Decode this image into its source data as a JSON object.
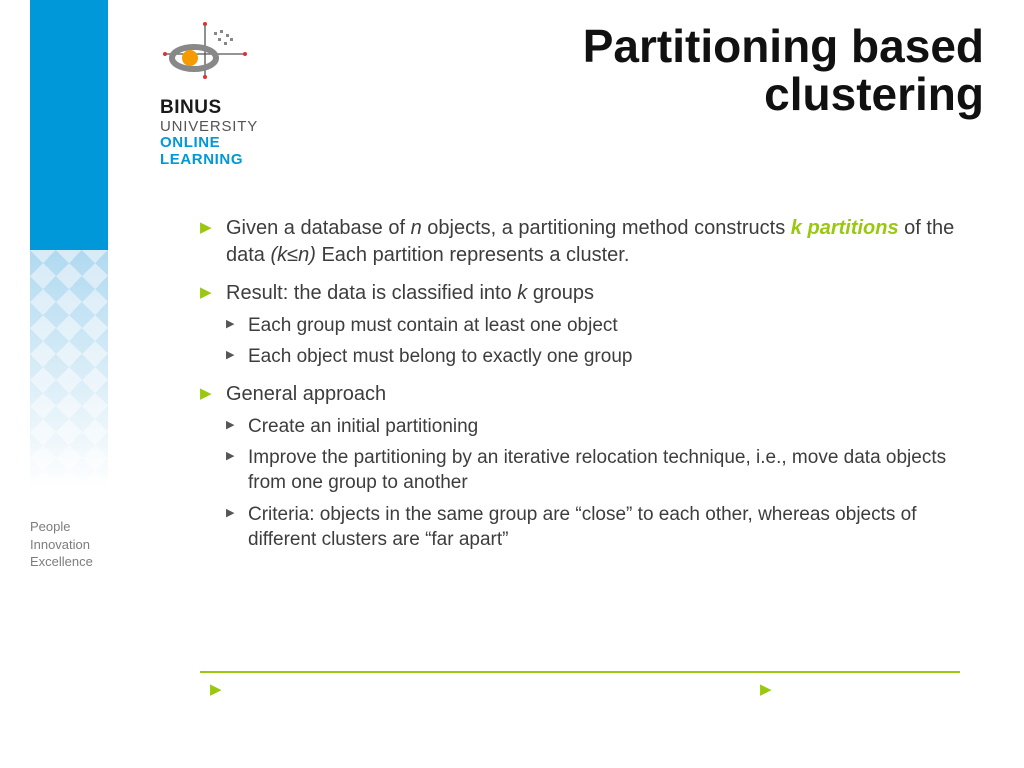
{
  "colors": {
    "accent_blue": "#0098d8",
    "accent_green": "#9ac80f"
  },
  "tagline": {
    "l1": "People",
    "l2": "Innovation",
    "l3": "Excellence"
  },
  "logo": {
    "line1": "BINUS",
    "line2": "UNIVERSITY",
    "line3": "ONLINE",
    "line4": "LEARNING"
  },
  "title": {
    "line1": "Partitioning based",
    "line2": "clustering"
  },
  "bullets": {
    "b1": {
      "pre": "Given a database of ",
      "var1": "n",
      "mid1": " objects, a partitioning method constructs ",
      "emph": "k partitions",
      "mid2": " of the data ",
      "cond": "(k≤n)",
      "post": " Each partition represents a cluster."
    },
    "b2": {
      "pre": "Result: the data is classified into ",
      "var1": "k",
      "post": " groups",
      "sub1": "Each group must contain at least one object",
      "sub2": "Each object must belong to exactly one group"
    },
    "b3": {
      "head": "General approach",
      "sub1": "Create an initial partitioning",
      "sub2": "Improve the partitioning by an iterative relocation technique, i.e., move data objects from one group to another",
      "sub3": "Criteria: objects in the same group are “close” to each other, whereas objects of different clusters are “far apart”"
    }
  },
  "nav": {
    "prev": "▶",
    "next": "▶"
  }
}
